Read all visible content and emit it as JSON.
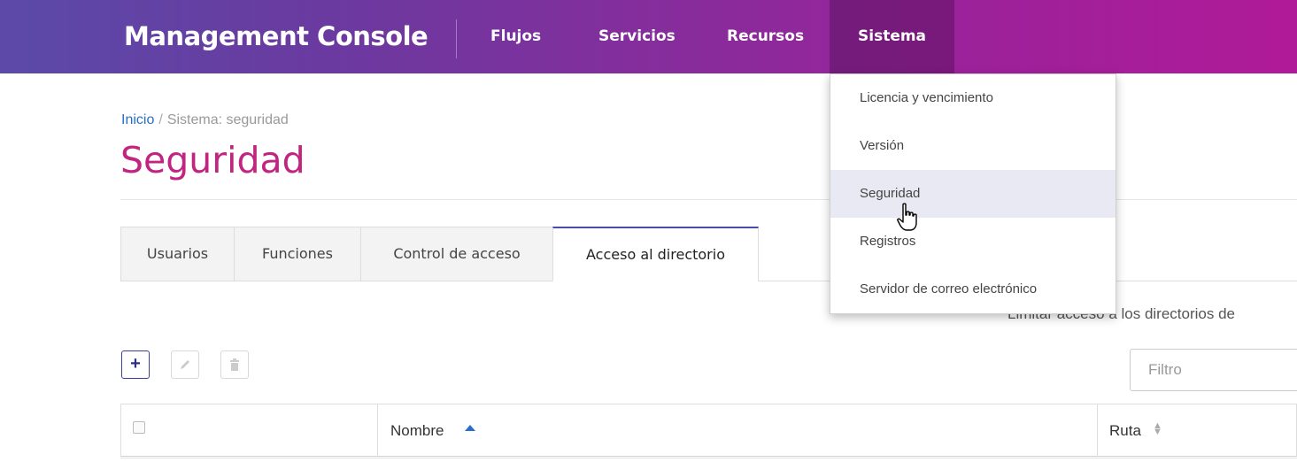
{
  "topbar": {
    "brand": "Management Console",
    "nav": [
      {
        "label": "Flujos"
      },
      {
        "label": "Servicios"
      },
      {
        "label": "Recursos"
      },
      {
        "label": "Sistema",
        "active": true
      }
    ]
  },
  "dropdown": {
    "items": [
      {
        "label": "Licencia y vencimiento"
      },
      {
        "label": "Versión"
      },
      {
        "label": "Seguridad",
        "highlighted": true
      },
      {
        "label": "Registros"
      },
      {
        "label": "Servidor de correo electrónico"
      }
    ]
  },
  "breadcrumb": {
    "home": "Inicio",
    "separator": "/",
    "current": "Sistema: seguridad"
  },
  "page": {
    "title": "Seguridad",
    "description": "Limitar acceso a los directorios de"
  },
  "tabs": [
    {
      "label": "Usuarios"
    },
    {
      "label": "Funciones"
    },
    {
      "label": "Control de acceso"
    },
    {
      "label": "Acceso al directorio",
      "active": true
    }
  ],
  "toolbar": {
    "add_icon": "plus-icon",
    "edit_icon": "pencil-icon",
    "delete_icon": "trash-icon",
    "filter_placeholder": "Filtro"
  },
  "table": {
    "columns": [
      {
        "label": "Nombre",
        "sort": "ascending"
      },
      {
        "label": "Ruta",
        "sort": "none"
      }
    ]
  },
  "colors": {
    "accent": "#c2257f",
    "link": "#2a6fc7",
    "primary_button": "#2e2e8a"
  }
}
